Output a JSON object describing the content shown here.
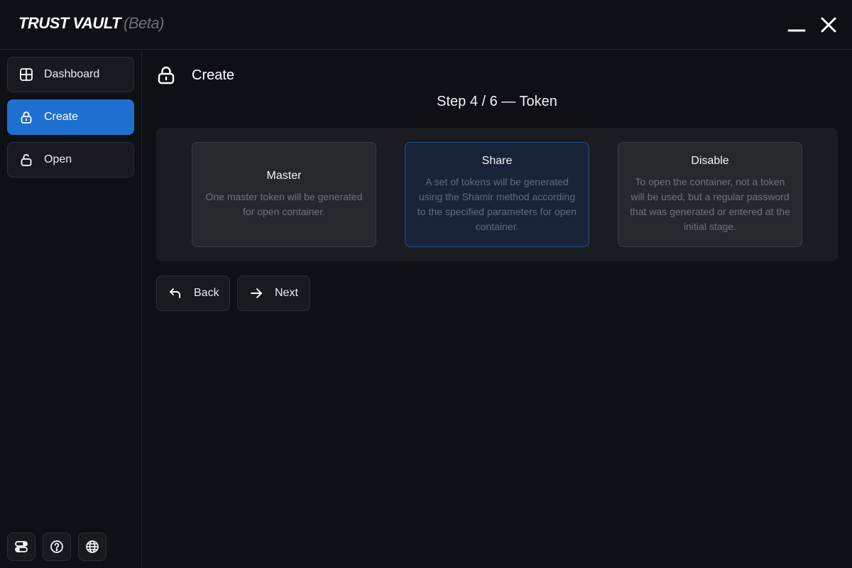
{
  "app": {
    "title": "TRUST VAULT",
    "badge": "(Beta)"
  },
  "window_controls": {
    "minimize_icon": "minimize-icon",
    "close_icon": "close-icon"
  },
  "sidebar": {
    "items": [
      {
        "label": "Dashboard",
        "icon": "grid-icon",
        "active": false
      },
      {
        "label": "Create",
        "icon": "lock-icon",
        "active": true
      },
      {
        "label": "Open",
        "icon": "unlock-icon",
        "active": false
      }
    ],
    "tools": [
      {
        "icon": "settings-toggle-icon"
      },
      {
        "icon": "help-icon"
      },
      {
        "icon": "globe-icon"
      }
    ]
  },
  "main": {
    "page_title": "Create",
    "step_title": "Step 4 / 6 — Token",
    "options": [
      {
        "title": "Master",
        "description": "One master token will be generated for open container.",
        "selected": false
      },
      {
        "title": "Share",
        "description": "A set of tokens will be generated using the Shamir method according to the specified parameters for open container.",
        "selected": true
      },
      {
        "title": "Disable",
        "description": "To open the container, not a token will be used, but a regular password that was generated or entered at the initial stage.",
        "selected": false
      }
    ],
    "back_label": "Back",
    "next_label": "Next"
  },
  "colors": {
    "background": "#0d1015",
    "accent": "#1f6fd0",
    "selected_card": "#17243a"
  }
}
